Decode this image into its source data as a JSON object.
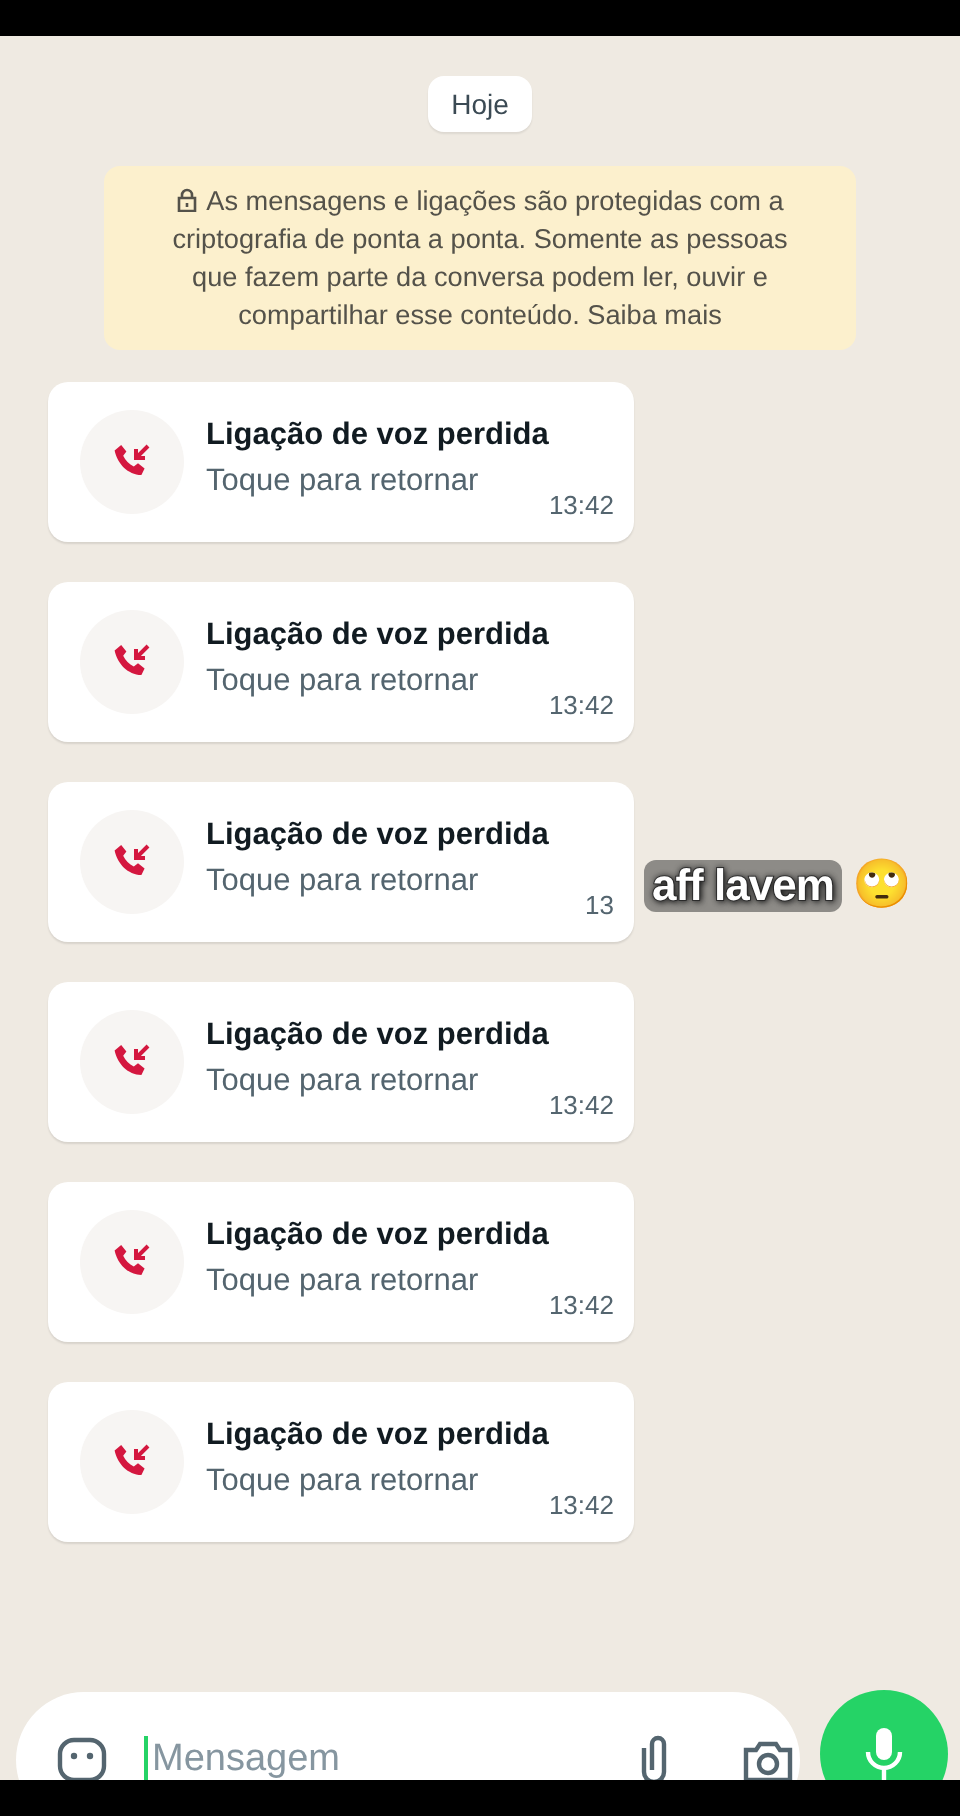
{
  "date_chip": "Hoje",
  "encryption_notice": "As mensagens e ligações são protegidas com a criptografia de ponta a ponta. Somente as pessoas que fazem parte da conversa podem ler, ouvir e compartilhar esse conteúdo. Saiba mais",
  "messages": [
    {
      "title": "Ligação de voz perdida",
      "subtitle": "Toque para retornar",
      "time": "13:42"
    },
    {
      "title": "Ligação de voz perdida",
      "subtitle": "Toque para retornar",
      "time": "13:42"
    },
    {
      "title": "Ligação de voz perdida",
      "subtitle": "Toque para retornar",
      "time": "13"
    },
    {
      "title": "Ligação de voz perdida",
      "subtitle": "Toque para retornar",
      "time": "13:42"
    },
    {
      "title": "Ligação de voz perdida",
      "subtitle": "Toque para retornar",
      "time": "13:42"
    },
    {
      "title": "Ligação de voz perdida",
      "subtitle": "Toque para retornar",
      "time": "13:42"
    }
  ],
  "caption": {
    "text": "aff lavem",
    "emoji": "🙄"
  },
  "composer": {
    "placeholder": "Mensagem"
  }
}
